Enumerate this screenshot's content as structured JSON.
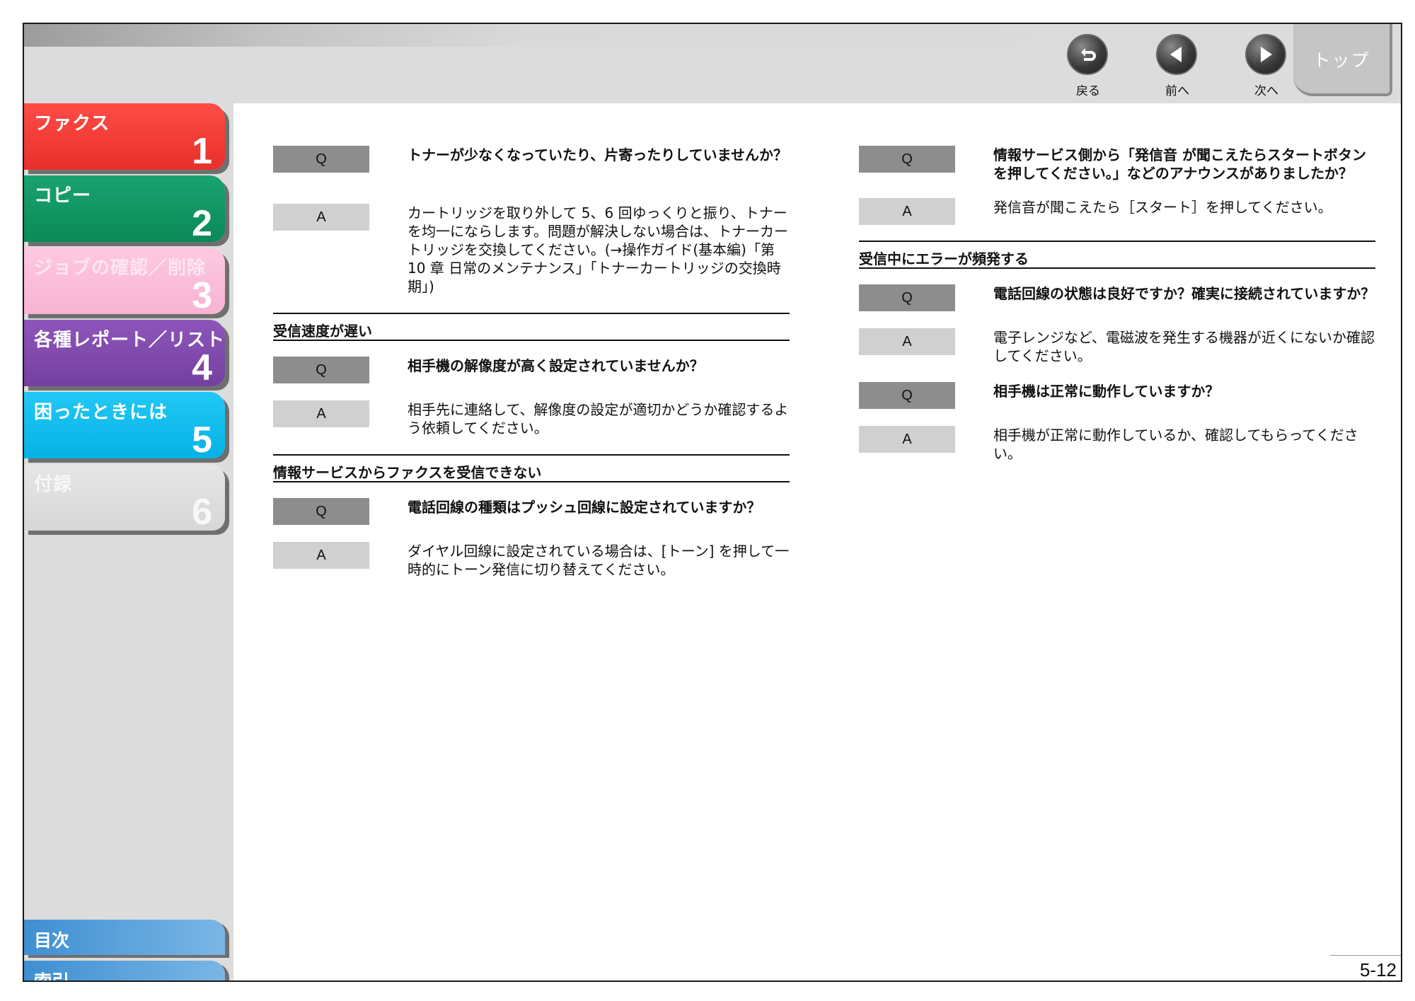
{
  "nav": {
    "back_label": "戻る",
    "prev_label": "前へ",
    "next_label": "次へ",
    "top_label": "トップ"
  },
  "sidebar": {
    "tabs": [
      {
        "label": "ファクス",
        "num": "1"
      },
      {
        "label": "コピー",
        "num": "2"
      },
      {
        "label": "ジョブの確認／削除",
        "num": "3"
      },
      {
        "label": "各種レポート／リスト",
        "num": "4"
      },
      {
        "label": "困ったときには",
        "num": "5"
      },
      {
        "label": "付録",
        "num": "6"
      }
    ],
    "toc_label": "目次",
    "index_label": "索引"
  },
  "badges": {
    "q": "Q",
    "a": "A"
  },
  "left": {
    "qa1": {
      "q": "トナーが少なくなっていたり、片寄ったりしていませんか？",
      "a": "カートリッジを取り外して 5、6 回ゆっくりと振り、トナーを均一にならします。問題が解決しない場合は、トナーカートリッジを交換してください。(→操作ガイド(基本編)「第 10 章 日常のメンテナンス」「トナーカートリッジの交換時期」)"
    },
    "sec1": "受信速度が遅い",
    "qa2": {
      "q": "相手機の解像度が高く設定されていませんか？",
      "a": "相手先に連絡して、解像度の設定が適切かどうか確認するよう依頼してください。"
    },
    "sec2": "情報サービスからファクスを受信できない",
    "qa3": {
      "q": "電話回線の種類はプッシュ回線に設定されていますか？",
      "a": "ダイヤル回線に設定されている場合は、[トーン] を押して一時的にトーン発信に切り替えてください。"
    }
  },
  "right": {
    "qa1": {
      "q": "情報サービス側から「発信音 が聞こえたらスタートボタンを押してください。」などのアナウンスがありましたか？",
      "a": "発信音が聞こえたら［スタート］を押してください。"
    },
    "sec1": "受信中にエラーが頻発する",
    "qa2": {
      "q": "電話回線の状態は良好ですか？確実に接続されていますか？",
      "a": "電子レンジなど、電磁波を発生する機器が近くにないか確認してください。"
    },
    "qa3": {
      "q": "相手機は正常に動作していますか？",
      "a": "相手機が正常に動作しているか、確認してもらってください。"
    }
  },
  "page_number": "5-12"
}
